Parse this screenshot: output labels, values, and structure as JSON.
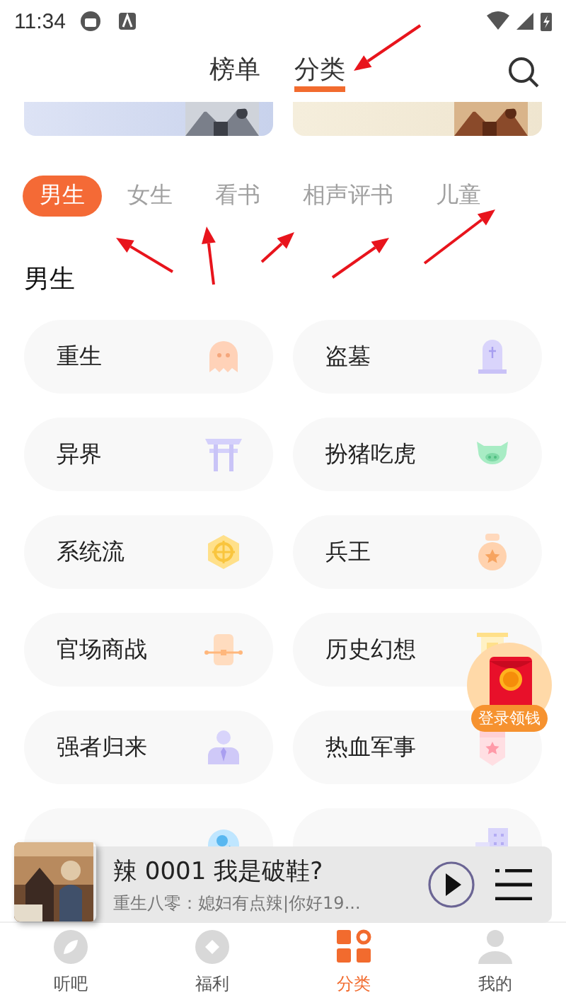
{
  "status_bar": {
    "time": "11:34"
  },
  "header_tabs": [
    {
      "label": "榜单",
      "selected": false
    },
    {
      "label": "分类",
      "selected": true
    }
  ],
  "sub_tabs": [
    {
      "label": "男生",
      "selected": true
    },
    {
      "label": "女生",
      "selected": false
    },
    {
      "label": "看书",
      "selected": false
    },
    {
      "label": "相声评书",
      "selected": false
    },
    {
      "label": "儿童",
      "selected": false
    }
  ],
  "section_title": "男生",
  "categories": [
    {
      "label": "重生"
    },
    {
      "label": "盗墓"
    },
    {
      "label": "异界"
    },
    {
      "label": "扮猪吃虎"
    },
    {
      "label": "系统流"
    },
    {
      "label": "兵王"
    },
    {
      "label": "官场商战"
    },
    {
      "label": "历史幻想"
    },
    {
      "label": "强者归来"
    },
    {
      "label": "热血军事"
    },
    {
      "kind": "cut_off"
    },
    {
      "kind": "cut_off"
    }
  ],
  "float_reward": {
    "label": "登录领钱"
  },
  "player": {
    "title": "辣 0001 我是破鞋?",
    "subtitle": "重生八零：媳妇有点辣|你好19..."
  },
  "bottom_nav": [
    {
      "label": "听吧",
      "selected": false
    },
    {
      "label": "福利",
      "selected": false
    },
    {
      "label": "分类",
      "selected": true
    },
    {
      "label": "我的",
      "selected": false
    }
  ],
  "annotations": [
    {
      "kind": "arrow"
    },
    {
      "kind": "arrow"
    },
    {
      "kind": "arrow"
    },
    {
      "kind": "arrow"
    },
    {
      "kind": "arrow"
    },
    {
      "kind": "arrow"
    }
  ]
}
